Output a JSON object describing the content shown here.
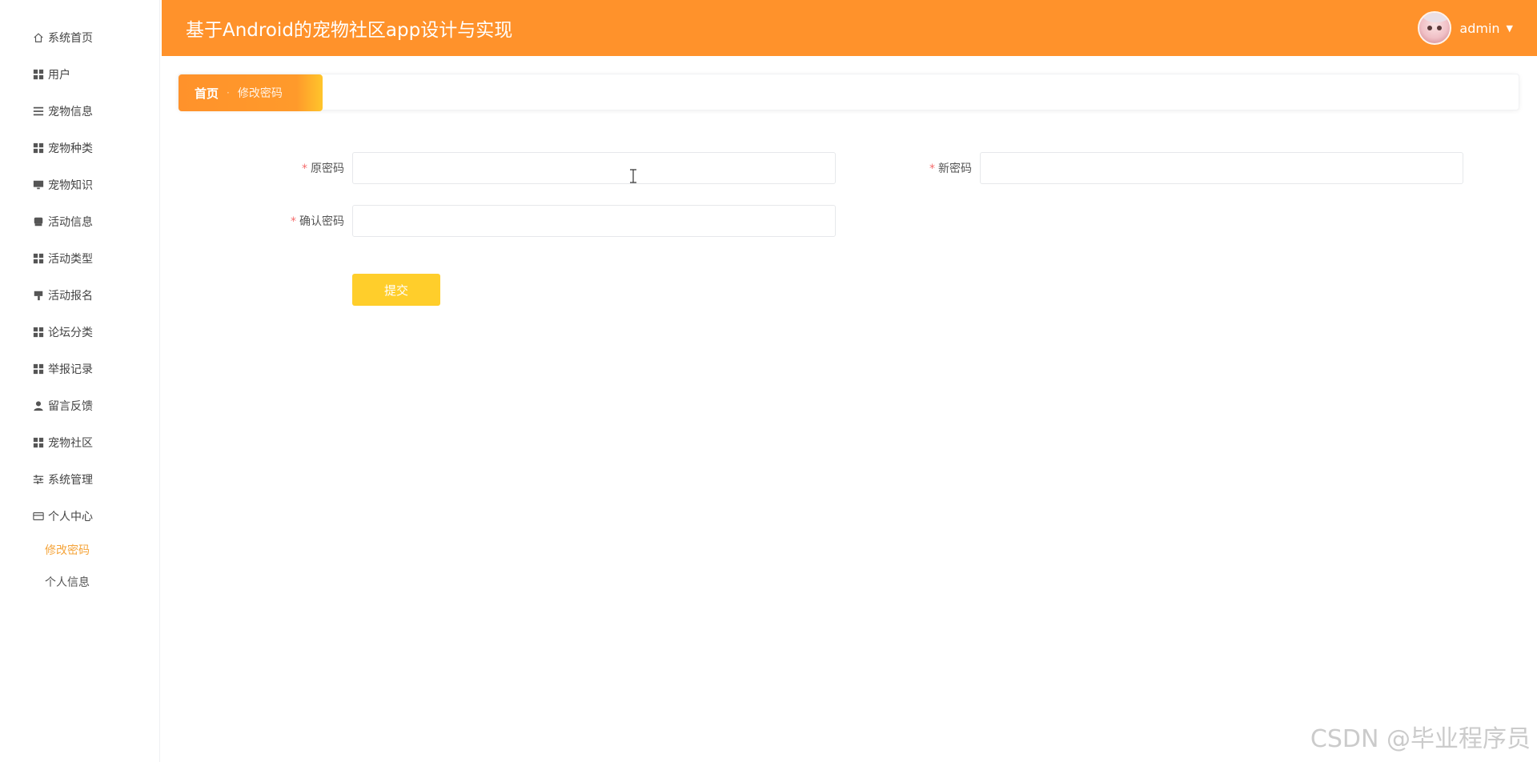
{
  "header": {
    "title": "基于Android的宠物社区app设计与实现",
    "username": "admin",
    "caret_icon": "▼"
  },
  "sidebar": {
    "items": [
      {
        "label": "系统首页",
        "icon": "home-icon"
      },
      {
        "label": "用户",
        "icon": "grid-icon"
      },
      {
        "label": "宠物信息",
        "icon": "list-icon"
      },
      {
        "label": "宠物种类",
        "icon": "grid-icon"
      },
      {
        "label": "宠物知识",
        "icon": "monitor-icon"
      },
      {
        "label": "活动信息",
        "icon": "chat-icon"
      },
      {
        "label": "活动类型",
        "icon": "grid-icon"
      },
      {
        "label": "活动报名",
        "icon": "sign-icon"
      },
      {
        "label": "论坛分类",
        "icon": "grid-icon"
      },
      {
        "label": "举报记录",
        "icon": "grid-icon"
      },
      {
        "label": "留言反馈",
        "icon": "user-icon"
      },
      {
        "label": "宠物社区",
        "icon": "grid-icon"
      },
      {
        "label": "系统管理",
        "icon": "sliders-icon"
      },
      {
        "label": "个人中心",
        "icon": "card-icon"
      }
    ],
    "submenu": [
      {
        "label": "修改密码",
        "active": true
      },
      {
        "label": "个人信息",
        "active": false
      }
    ]
  },
  "breadcrumb": {
    "home": "首页",
    "separator": "·",
    "current": "修改密码"
  },
  "form": {
    "required_mark": "*",
    "old_password": {
      "label": "原密码",
      "value": ""
    },
    "new_password": {
      "label": "新密码",
      "value": ""
    },
    "confirm_password": {
      "label": "确认密码",
      "value": ""
    },
    "submit_label": "提交"
  },
  "watermark": "CSDN @毕业程序员",
  "colors": {
    "header_bg": "#ff922b",
    "accent": "#f5a43a",
    "submit_bg": "#ffce2b",
    "required": "#f56c6c"
  }
}
